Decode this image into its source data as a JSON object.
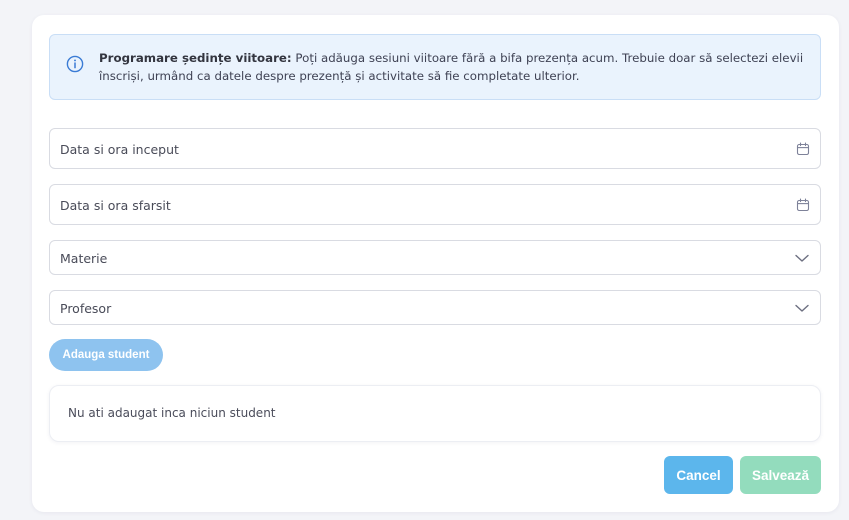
{
  "info": {
    "title": "Programare ședințe viitoare:",
    "message": "Poți adăuga sesiuni viitoare fără a bifa prezența acum. Trebuie doar să selectezi elevii înscriși, urmând ca datele despre prezență și activitate să fie completate ulterior.",
    "icon": "info-circle-icon"
  },
  "form": {
    "start_datetime": {
      "placeholder": "Data si ora inceput",
      "icon": "calendar-icon"
    },
    "end_datetime": {
      "placeholder": "Data si ora sfarsit",
      "icon": "calendar-icon"
    },
    "subject": {
      "placeholder": "Materie",
      "icon": "chevron-down-icon"
    },
    "teacher": {
      "placeholder": "Profesor",
      "icon": "chevron-down-icon"
    }
  },
  "students": {
    "add_label": "Adauga student",
    "empty_message": "Nu ati adaugat inca niciun student"
  },
  "actions": {
    "cancel_label": "Cancel",
    "save_label": "Salvează"
  },
  "colors": {
    "primary": "#5cb6ec",
    "primary_disabled": "#8ec3ef",
    "success_disabled": "#93dcbd",
    "info_bg": "#eaf3fd",
    "info_border": "#c9def6"
  }
}
